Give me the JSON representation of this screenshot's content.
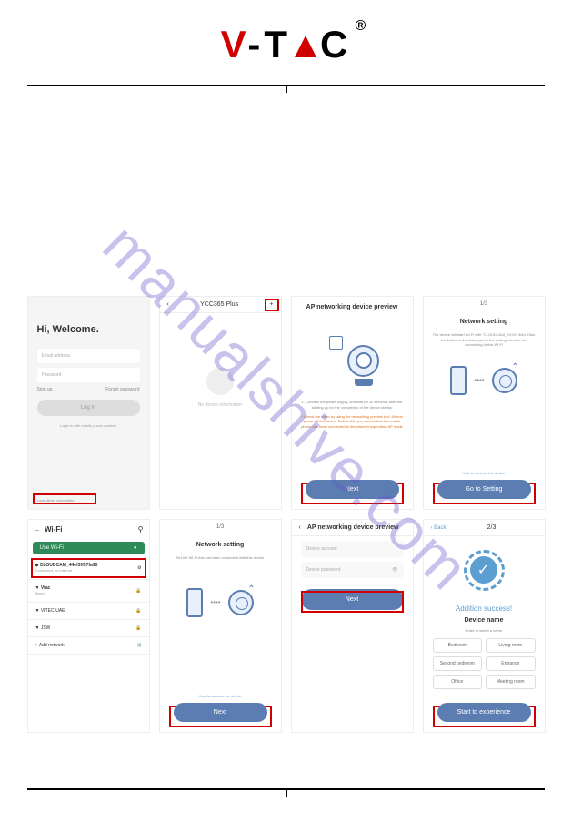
{
  "logo": {
    "v": "V",
    "dash": "-",
    "t": "T",
    "a": "A",
    "c": "C",
    "r": "®"
  },
  "watermark": "manualshive.com",
  "shots": {
    "s1": {
      "welcome": "Hi, Welcome.",
      "email": "Email address",
      "password": "Password",
      "signup": "Sign up",
      "forgot": "Forget password",
      "login": "Log in",
      "mobile_login": "Login in with mobile phone number",
      "local": "Local direct connection"
    },
    "s2": {
      "back": "‹",
      "title": "YCC365 Plus",
      "plus": "+",
      "empty": "No device information"
    },
    "s3": {
      "title": "AP networking device preview",
      "step": "1. Connect the power supply, and wait for 30 seconds after the starting up for the completion of the device startup",
      "warn": "* Check the video by using the networking preview tool. All real power off the device. Before this, you ensure that the mobile phone has been connected to the channel supporting AP mode",
      "btn": "Next"
    },
    "s4": {
      "step": "1/3",
      "title": "Network setting",
      "desc": "The device will start Wi-Fi with \"CLOUDCAM_XXXX\" field. Click the button in the lower part to the setting interface for connecting to this Wi-Fi",
      "link": "How to connect the device",
      "btn": "Go to Setting"
    },
    "s5": {
      "back": "←",
      "title": "Wi-Fi",
      "use": "Use Wi-Fi",
      "cloud": "CLOUDCAM_44ef3ff57fa90",
      "cloud_sub": "Connected, no internet",
      "vtac": "Vtac",
      "vtac_sub": "Saved",
      "vitec": "VITEC-UAE",
      "jsw": "JSW",
      "add": "Add network"
    },
    "s6": {
      "step": "1/3",
      "title": "Network setting",
      "desc": "Set the Wi-Fi that has been connected with this device",
      "link": "How to connect the device",
      "btn": "Next"
    },
    "s7": {
      "back": "‹",
      "title": "AP networking device preview",
      "account": "Device account",
      "password": "Device password",
      "btn": "Next"
    },
    "s8": {
      "back": "‹ Back",
      "step": "2/3",
      "success": "Addition success!",
      "device": "Device name",
      "prompt": "Enter or select a name",
      "rooms": [
        "Bedroom",
        "Living room",
        "Second bedroom",
        "Entrance",
        "Office",
        "Meeting room"
      ],
      "btn": "Start to experience"
    }
  }
}
